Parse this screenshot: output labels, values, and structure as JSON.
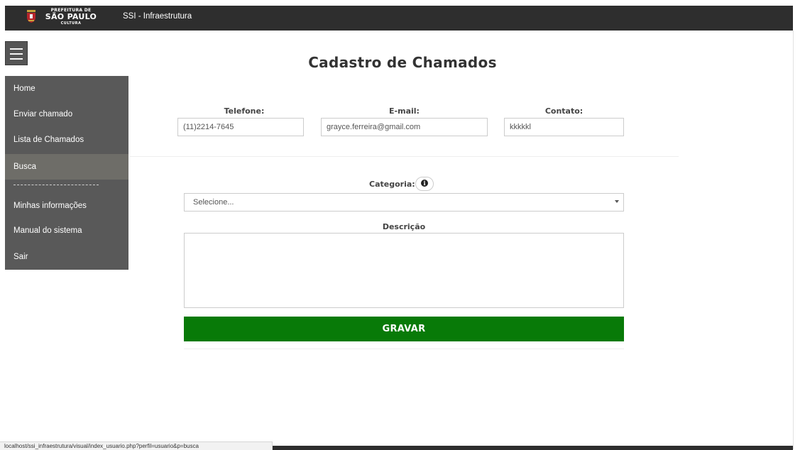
{
  "header": {
    "logo_line1": "PREFEITURA DE",
    "logo_line2": "SÃO PAULO",
    "logo_line3": "CULTURA",
    "system_name": "SSI - Infraestrutura"
  },
  "sidebar": {
    "items": [
      {
        "label": "Home"
      },
      {
        "label": "Enviar chamado"
      },
      {
        "label": "Lista de Chamados"
      },
      {
        "label": "Busca"
      },
      {
        "label": "Minhas informações"
      },
      {
        "label": "Manual do sistema"
      },
      {
        "label": "Sair"
      }
    ],
    "active": "Busca"
  },
  "form": {
    "title": "Cadastro de Chamados",
    "telefone_label": "Telefone:",
    "telefone_value": "(11)2214-7645",
    "email_label": "E-mail:",
    "email_value": "grayce.ferreira@gmail.com",
    "contato_label": "Contato:",
    "contato_value": "kkkkkl",
    "categoria_label": "Categoria:",
    "categoria_value": "Selecione...",
    "descricao_label": "Descrição",
    "descricao_value": "",
    "save_label": "GRAVAR"
  },
  "statusbar": {
    "url": "localhost/ssi_infraestrutura/visual/index_usuario.php?perfil=usuario&p=busca"
  },
  "colors": {
    "topbar": "#2e2e2e",
    "sidebar": "#595959",
    "sidebar_active": "#6e6d68",
    "save_button": "#087a08"
  },
  "icons": {
    "menu": "hamburger-icon",
    "info": "info-icon",
    "caret": "caret-down-icon",
    "crest": "sao-paulo-crest-icon"
  }
}
